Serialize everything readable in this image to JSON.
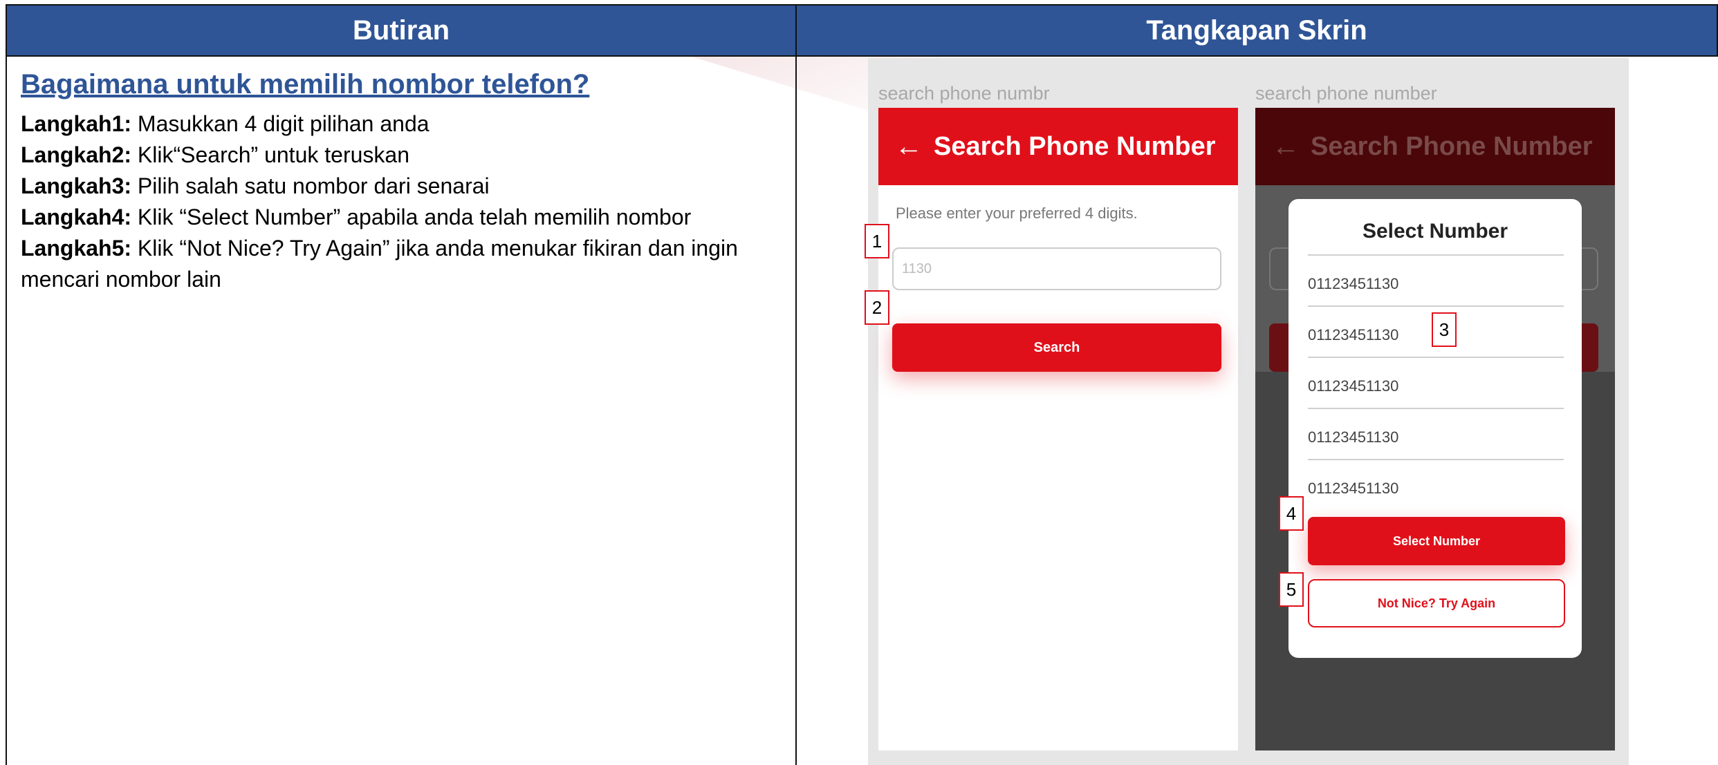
{
  "table": {
    "col_left_header": "Butiran",
    "col_right_header": "Tangkapan Skrin"
  },
  "guide": {
    "title": "Bagaimana untuk memilih nombor telefon?",
    "steps": [
      {
        "label": "Langkah1:",
        "text": " Masukkan 4 digit pilihan anda"
      },
      {
        "label": "Langkah2:",
        "text": " Klik“Search” untuk teruskan"
      },
      {
        "label": "Langkah3:",
        "text": " Pilih salah satu nombor dari senarai"
      },
      {
        "label": "Langkah4:",
        "text": " Klik “Select Number” apabila anda telah memilih nombor"
      },
      {
        "label": "Langkah5:",
        "text": " Klik “Not Nice? Try Again” jika anda menukar fikiran dan ingin mencari nombor lain"
      }
    ]
  },
  "screen1": {
    "caption": "search phone numbr",
    "back_icon": "arrow-left-icon",
    "appbar_title": "Search Phone Number",
    "hint": "Please enter your preferred 4 digits.",
    "input_placeholder": "1130",
    "search_label": "Search"
  },
  "screen2": {
    "caption": "search phone number",
    "back_icon": "arrow-left-icon",
    "appbar_title": "Search Phone Number",
    "modal_title": "Select Number",
    "numbers": [
      "01123451130",
      "01123451130",
      "01123451130",
      "01123451130",
      "01123451130"
    ],
    "select_label": "Select Number",
    "retry_label": "Not Nice? Try Again"
  },
  "markers": [
    "1",
    "2",
    "3",
    "4",
    "5"
  ],
  "colors": {
    "header_blue": "#2f5597",
    "brand_red": "#e0101a"
  }
}
